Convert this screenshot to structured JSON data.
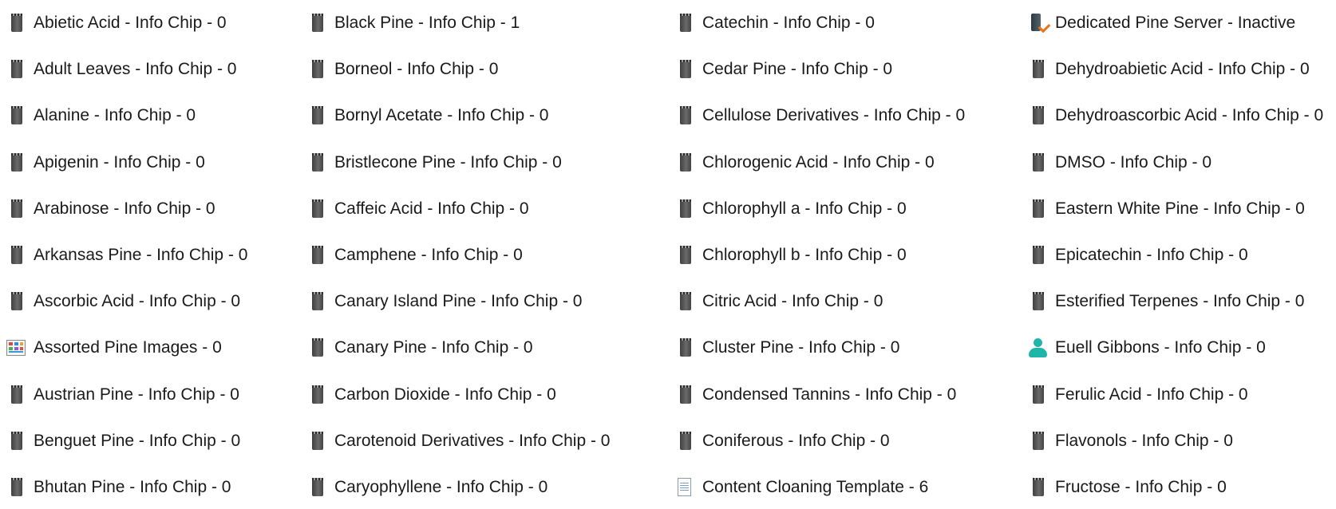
{
  "columns": [
    {
      "items": [
        {
          "icon": "chip-icon",
          "label": "Abietic Acid - Info Chip - 0"
        },
        {
          "icon": "chip-icon",
          "label": "Adult Leaves - Info Chip - 0"
        },
        {
          "icon": "chip-icon",
          "label": "Alanine - Info Chip - 0"
        },
        {
          "icon": "chip-icon",
          "label": "Apigenin - Info Chip - 0"
        },
        {
          "icon": "chip-icon",
          "label": "Arabinose - Info Chip - 0"
        },
        {
          "icon": "chip-icon",
          "label": "Arkansas Pine - Info Chip - 0"
        },
        {
          "icon": "chip-icon",
          "label": "Ascorbic Acid - Info Chip - 0"
        },
        {
          "icon": "images-icon",
          "label": "Assorted Pine Images - 0"
        },
        {
          "icon": "chip-icon",
          "label": "Austrian Pine - Info Chip - 0"
        },
        {
          "icon": "chip-icon",
          "label": "Benguet Pine - Info Chip - 0"
        },
        {
          "icon": "chip-icon",
          "label": "Bhutan Pine - Info Chip - 0"
        }
      ]
    },
    {
      "items": [
        {
          "icon": "chip-icon",
          "label": "Black Pine - Info Chip - 1"
        },
        {
          "icon": "chip-icon",
          "label": "Borneol - Info Chip - 0"
        },
        {
          "icon": "chip-icon",
          "label": "Bornyl Acetate - Info Chip - 0"
        },
        {
          "icon": "chip-icon",
          "label": "Bristlecone Pine - Info Chip - 0"
        },
        {
          "icon": "chip-icon",
          "label": "Caffeic Acid - Info Chip - 0"
        },
        {
          "icon": "chip-icon",
          "label": "Camphene - Info Chip - 0"
        },
        {
          "icon": "chip-icon",
          "label": "Canary Island Pine - Info Chip - 0"
        },
        {
          "icon": "chip-icon",
          "label": "Canary Pine - Info Chip - 0"
        },
        {
          "icon": "chip-icon",
          "label": "Carbon Dioxide - Info Chip - 0"
        },
        {
          "icon": "chip-icon",
          "label": "Carotenoid Derivatives - Info Chip - 0"
        },
        {
          "icon": "chip-icon",
          "label": "Caryophyllene - Info Chip - 0"
        }
      ]
    },
    {
      "items": [
        {
          "icon": "chip-icon",
          "label": "Catechin - Info Chip - 0"
        },
        {
          "icon": "chip-icon",
          "label": "Cedar Pine - Info Chip - 0"
        },
        {
          "icon": "chip-icon",
          "label": "Cellulose Derivatives - Info Chip - 0"
        },
        {
          "icon": "chip-icon",
          "label": "Chlorogenic Acid - Info Chip - 0"
        },
        {
          "icon": "chip-icon",
          "label": "Chlorophyll a - Info Chip - 0"
        },
        {
          "icon": "chip-icon",
          "label": "Chlorophyll b - Info Chip - 0"
        },
        {
          "icon": "chip-icon",
          "label": "Citric Acid - Info Chip - 0"
        },
        {
          "icon": "chip-icon",
          "label": "Cluster Pine - Info Chip - 0"
        },
        {
          "icon": "chip-icon",
          "label": "Condensed Tannins - Info Chip - 0"
        },
        {
          "icon": "chip-icon",
          "label": "Coniferous - Info Chip - 0"
        },
        {
          "icon": "document-icon",
          "label": "Content Cloaning Template - 6"
        }
      ]
    },
    {
      "items": [
        {
          "icon": "server-icon",
          "label": "Dedicated Pine Server - Inactive"
        },
        {
          "icon": "chip-icon",
          "label": "Dehydroabietic Acid - Info Chip - 0"
        },
        {
          "icon": "chip-icon",
          "label": "Dehydroascorbic Acid - Info Chip - 0"
        },
        {
          "icon": "chip-icon",
          "label": "DMSO - Info Chip - 0"
        },
        {
          "icon": "chip-icon",
          "label": "Eastern White Pine - Info Chip - 0"
        },
        {
          "icon": "chip-icon",
          "label": "Epicatechin - Info Chip - 0"
        },
        {
          "icon": "chip-icon",
          "label": "Esterified Terpenes - Info Chip - 0"
        },
        {
          "icon": "person-icon",
          "label": "Euell Gibbons - Info Chip - 0"
        },
        {
          "icon": "chip-icon",
          "label": "Ferulic Acid - Info Chip - 0"
        },
        {
          "icon": "chip-icon",
          "label": "Flavonols - Info Chip - 0"
        },
        {
          "icon": "chip-icon",
          "label": "Fructose - Info Chip - 0"
        }
      ]
    }
  ]
}
